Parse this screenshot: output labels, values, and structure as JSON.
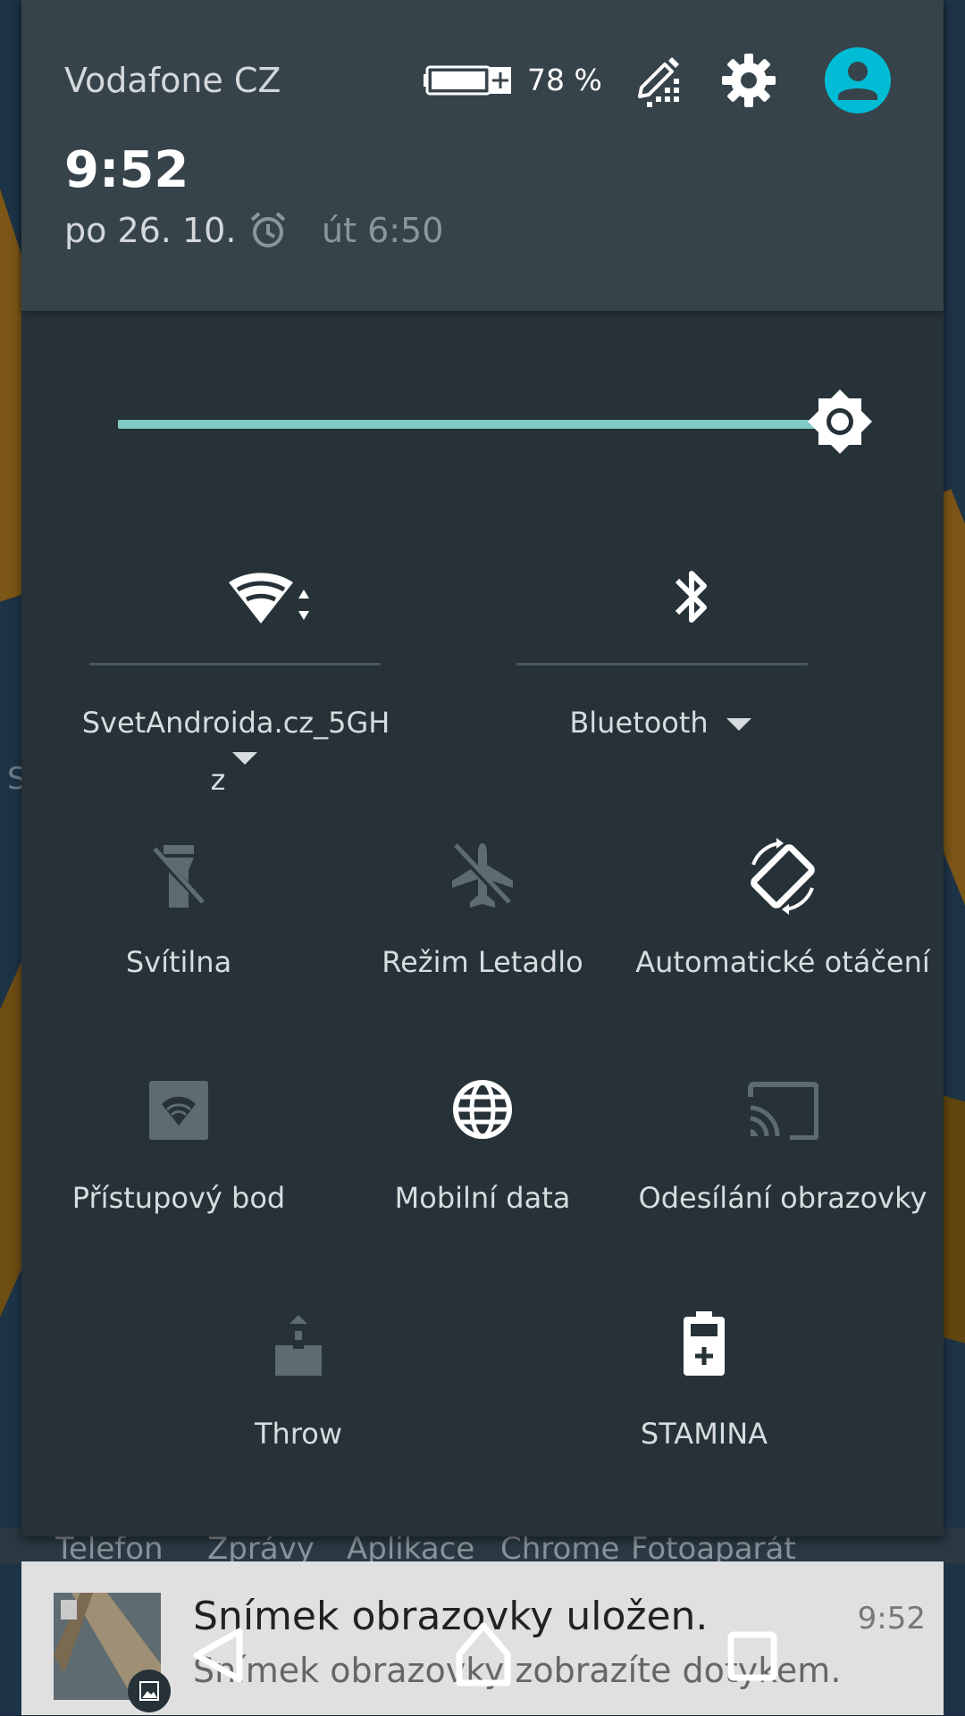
{
  "status": {
    "carrier": "Vodafone CZ",
    "battery_percent_label": "78 %",
    "battery_level": 0.78,
    "time": "9:52",
    "date": "po 26. 10.",
    "next_alarm": "út 6:50"
  },
  "brightness": {
    "level": 0.95
  },
  "wide_tiles": {
    "wifi": {
      "label_line1": "SvetAndroida.cz_5GH",
      "label_line2": "z"
    },
    "bluetooth": {
      "label": "Bluetooth"
    }
  },
  "tiles": {
    "flashlight": "Svítilna",
    "airplane": "Režim Letadlo",
    "autorotate": "Automatické otáčení",
    "hotspot": "Přístupový bod",
    "mobile_data": "Mobilní data",
    "cast": "Odesílání obrazovky",
    "throw": "Throw",
    "stamina": "STAMINA"
  },
  "dock": [
    "Telefon",
    "Zprávy",
    "Aplikace",
    "Chrome",
    "Fotoaparát"
  ],
  "wallpaper_side_letter": "S",
  "notification": {
    "title": "Snímek obrazovky uložen.",
    "text": "Snímek obrazovky zobrazíte dotykem.",
    "time": "9:52"
  },
  "colors": {
    "accent": "#80cbc4",
    "avatar": "#00bcd4",
    "shade": "#263238",
    "header": "#37434b"
  }
}
